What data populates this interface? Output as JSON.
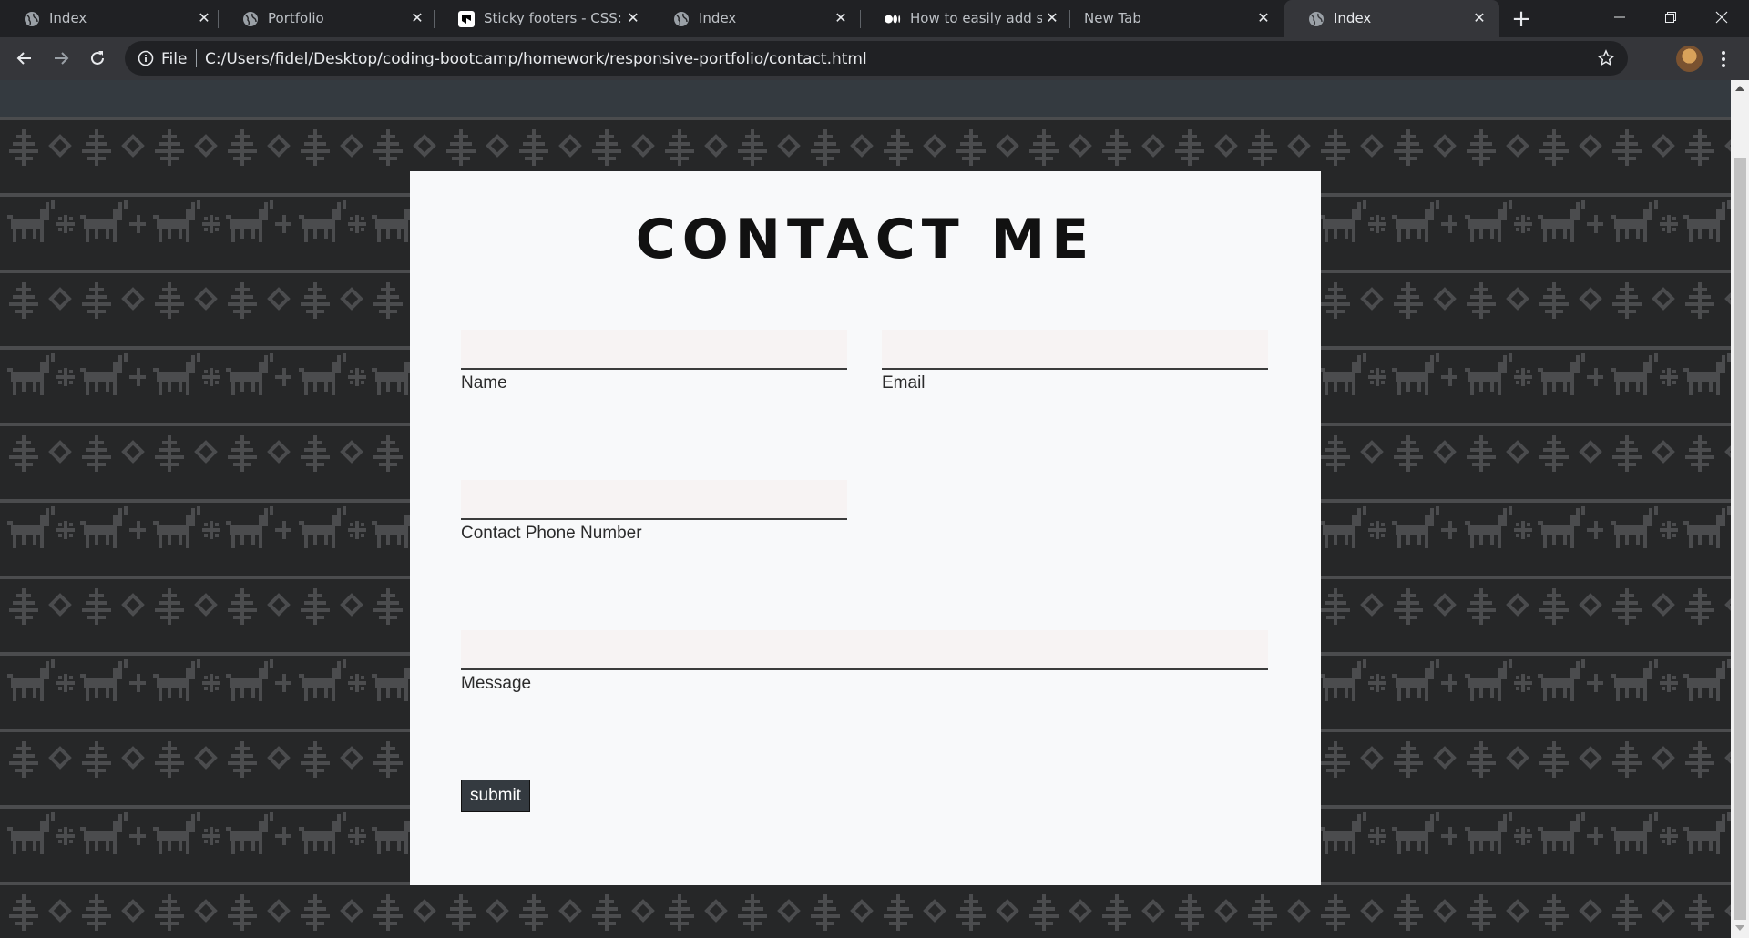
{
  "browser": {
    "tabs": [
      {
        "title": "Index",
        "favicon": "globe-icon",
        "active": false
      },
      {
        "title": "Portfolio",
        "favicon": "globe-icon",
        "active": false
      },
      {
        "title": "Sticky footers - CSS: Cascading Style Sheets",
        "favicon": "mdn-icon",
        "active": false
      },
      {
        "title": "Index",
        "favicon": "globe-icon",
        "active": false
      },
      {
        "title": "How to easily add screenshots",
        "favicon": "medium-icon",
        "active": false
      },
      {
        "title": "New Tab",
        "favicon": "",
        "active": false
      },
      {
        "title": "Index",
        "favicon": "globe-icon",
        "active": true
      }
    ],
    "omnibox": {
      "scheme_label": "File",
      "url": "C:/Users/fidel/Desktop/coding-bootcamp/homework/responsive-portfolio/contact.html"
    }
  },
  "page": {
    "title": "CONTACT ME",
    "fields": {
      "name_label": "Name",
      "email_label": "Email",
      "phone_label": "Contact Phone Number",
      "message_label": "Message"
    },
    "submit_label": "submit"
  },
  "colors": {
    "tabstrip_bg": "#202124",
    "toolbar_bg": "#35363a",
    "page_navbar": "#343a40",
    "pattern_bg": "#262728",
    "pattern_fg": "#4b4c4e",
    "card_bg": "#f8f9fa",
    "submit_bg": "#343a40"
  }
}
